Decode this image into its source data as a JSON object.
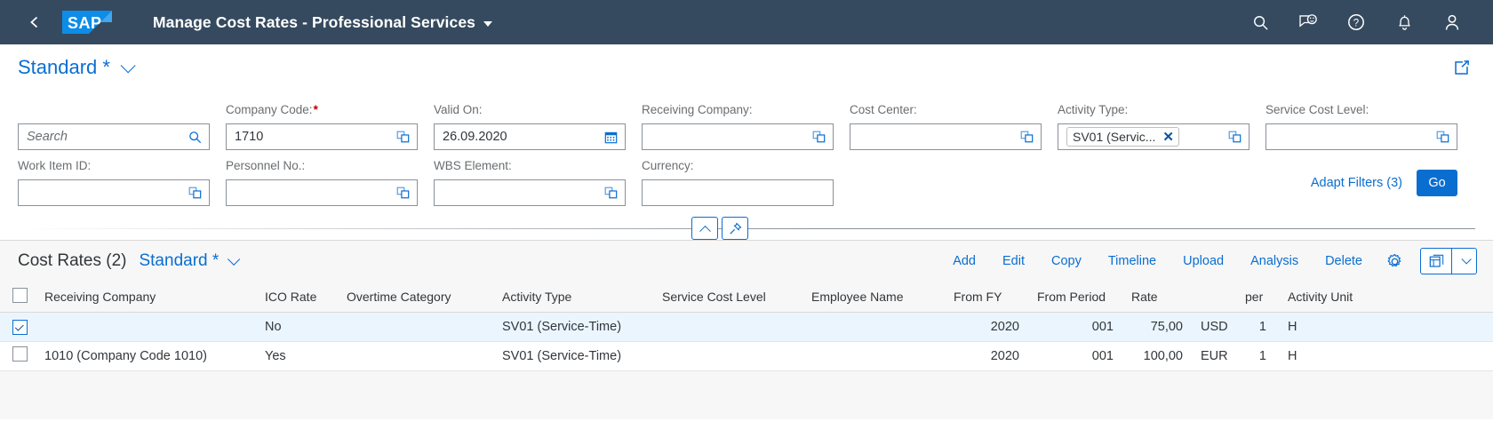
{
  "shell": {
    "back_icon": "navigate-back-icon",
    "logo_text": "SAP",
    "title": "Manage Cost Rates - Professional Services",
    "icons": [
      "search-icon",
      "feedback-icon",
      "help-icon",
      "notifications-icon",
      "user-avatar-icon"
    ],
    "bg_color": "#354a5f"
  },
  "variant": {
    "label": "Standard *",
    "share_icon": "share-icon"
  },
  "filters": {
    "search": {
      "label": "",
      "placeholder": "Search",
      "value": "",
      "icon": "search-icon"
    },
    "fields": [
      {
        "label": "Company Code:",
        "required": true,
        "value": "1710",
        "icon": "value-help-icon"
      },
      {
        "label": "Valid On:",
        "required": false,
        "value": "26.09.2020",
        "icon": "calendar-icon"
      },
      {
        "label": "Receiving Company:",
        "required": false,
        "value": "",
        "icon": "value-help-icon"
      },
      {
        "label": "Cost Center:",
        "required": false,
        "value": "",
        "icon": "value-help-icon"
      },
      {
        "label": "Activity Type:",
        "required": false,
        "value": "",
        "icon": "value-help-icon",
        "token": "SV01 (Servic..."
      },
      {
        "label": "Service Cost Level:",
        "required": false,
        "value": "",
        "icon": "value-help-icon"
      },
      {
        "label": "Work Item ID:",
        "required": false,
        "value": "",
        "icon": "value-help-icon"
      },
      {
        "label": "Personnel No.:",
        "required": false,
        "value": "",
        "icon": "value-help-icon"
      },
      {
        "label": "WBS Element:",
        "required": false,
        "value": "",
        "icon": "value-help-icon"
      },
      {
        "label": "Currency:",
        "required": false,
        "value": "",
        "icon": ""
      }
    ],
    "adapt_filters_label": "Adapt Filters (3)",
    "go_label": "Go",
    "collapse_icon": "chevron-up-icon",
    "pin_icon": "pin-icon"
  },
  "table": {
    "title": "Cost Rates (2)",
    "variant_label": "Standard *",
    "actions": [
      "Add",
      "Edit",
      "Copy",
      "Timeline",
      "Upload",
      "Analysis",
      "Delete"
    ],
    "settings_icon": "gear-icon",
    "view_icon": "table-view-icon",
    "view_more_icon": "chevron-down-icon",
    "columns": [
      "Receiving Company",
      "ICO Rate",
      "Overtime Category",
      "Activity Type",
      "Service Cost Level",
      "Employee Name",
      "From FY",
      "From Period",
      "Rate",
      "per",
      "Activity Unit"
    ],
    "rows": [
      {
        "selected": true,
        "receiving_company": "",
        "ico_rate": "No",
        "overtime_category": "",
        "activity_type": "SV01 (Service-Time)",
        "service_cost_level": "",
        "employee_name": "",
        "from_fy": "2020",
        "from_period": "001",
        "rate": "75,00",
        "currency": "USD",
        "per": "1",
        "activity_unit": "H"
      },
      {
        "selected": false,
        "receiving_company": "1010 (Company Code 1010)",
        "ico_rate": "Yes",
        "overtime_category": "",
        "activity_type": "SV01 (Service-Time)",
        "service_cost_level": "",
        "employee_name": "",
        "from_fy": "2020",
        "from_period": "001",
        "rate": "100,00",
        "currency": "EUR",
        "per": "1",
        "activity_unit": "H"
      }
    ]
  },
  "colors": {
    "accent": "#0a6ed1",
    "shell": "#354a5f",
    "required": "#bb0000",
    "selected_row": "#ebf5fe"
  }
}
